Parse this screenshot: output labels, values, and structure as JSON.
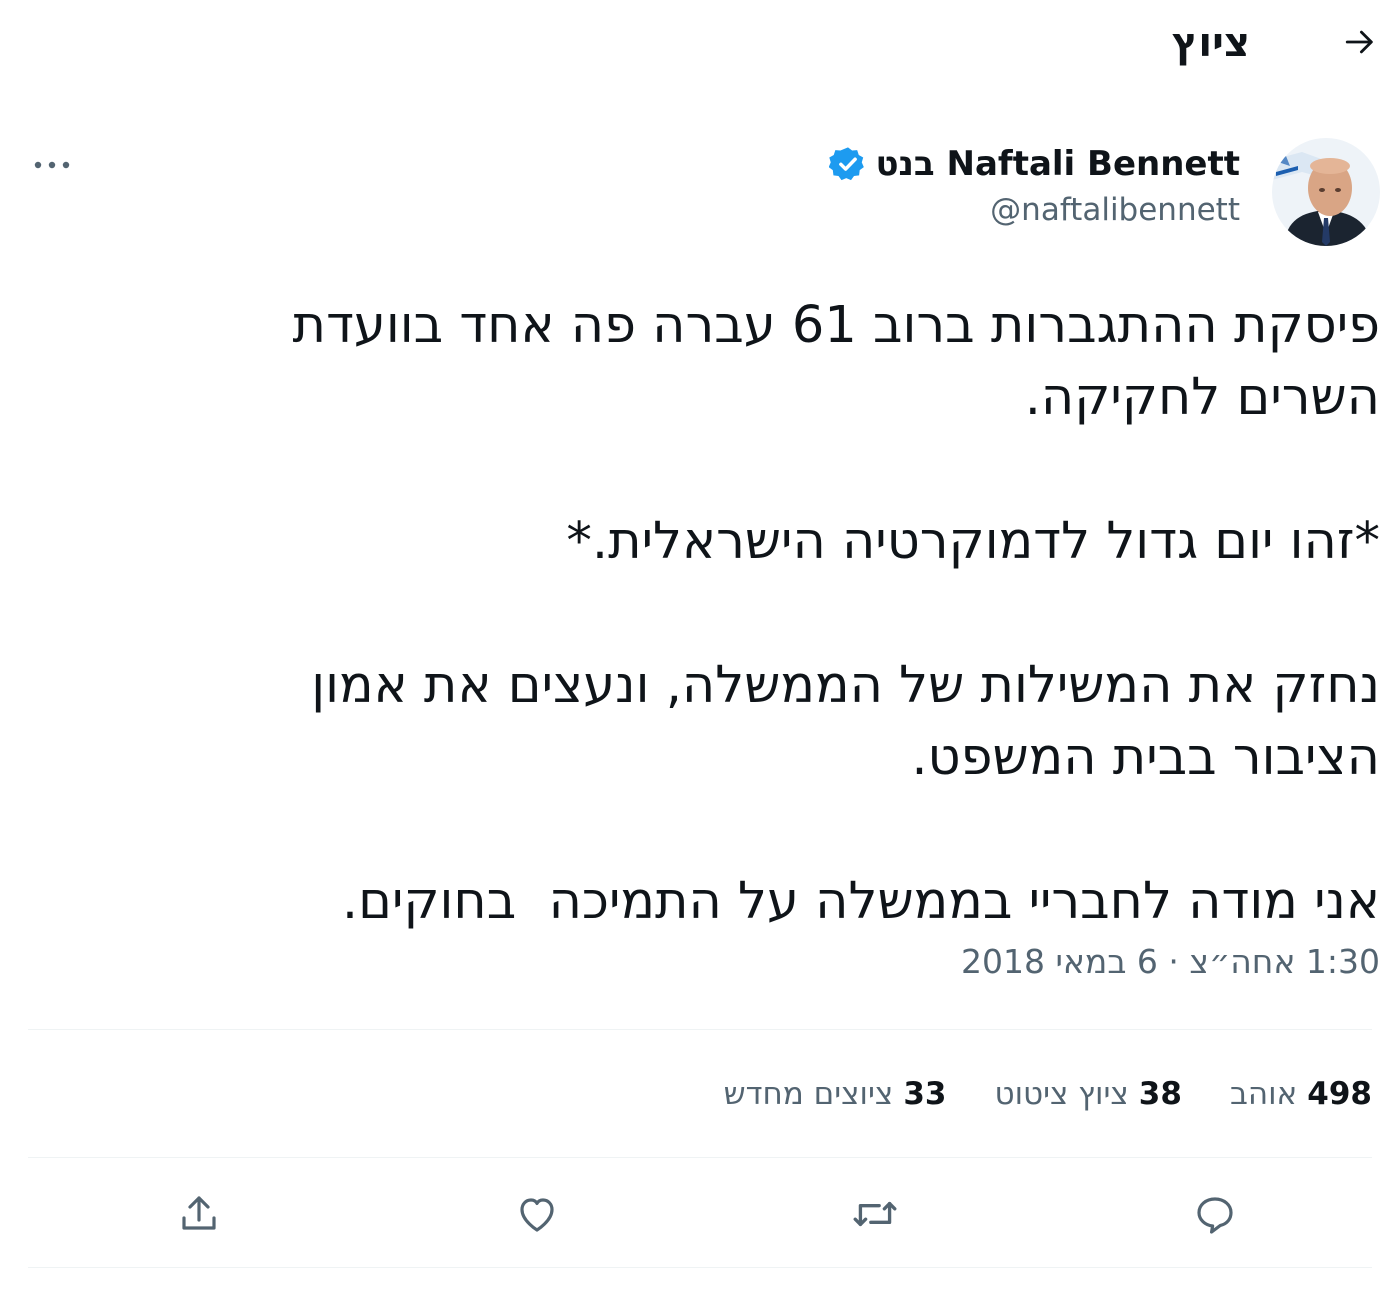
{
  "header": {
    "title": "ציוץ",
    "back_icon": "arrow-right-icon"
  },
  "author": {
    "display_name": "Naftali Bennett בנט",
    "handle": "@naftalibennett",
    "verified_icon": "verified-badge-icon",
    "avatar_icon": "profile-photo",
    "more_icon": "more-horizontal-icon"
  },
  "tweet": {
    "text": "פיסקת ההתגברות ברוב 61 עברה פה אחד בוועדת השרים לחקיקה.\n\n*זהו יום גדול לדמוקרטיה הישראלית.*\n\nנחזק את המשילות של הממשלה, ונעצים את אמון הציבור בבית המשפט.\n\nאני מודה לחבריי בממשלה על התמיכה  בחוקים.",
    "timestamp": "1:30 אחה״צ · 6 במאי 2018"
  },
  "stats": [
    {
      "count": "33",
      "label": "ציוצים מחדש"
    },
    {
      "count": "38",
      "label": "ציוץ ציטוט"
    },
    {
      "count": "498",
      "label": "אוהב"
    }
  ],
  "actions": [
    "reply-icon",
    "retweet-icon",
    "like-icon",
    "share-icon"
  ],
  "colors": {
    "text": "#0f1419",
    "secondary": "#536471",
    "verified": "#1d9bf0",
    "divider": "#eff3f4"
  }
}
